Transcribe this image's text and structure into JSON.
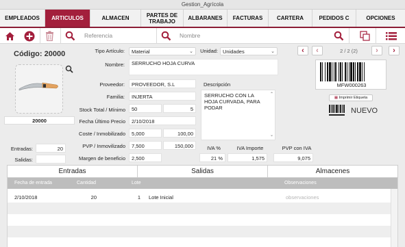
{
  "window": {
    "title": "Gestion_Agrícola"
  },
  "nav": {
    "tabs": [
      "EMPLEADOS",
      "ARTICULOS",
      "ALMACEN",
      "PARTES DE\nTRABAJO",
      "ALBARANES",
      "FACTURAS",
      "CARTERA",
      "PEDIDOS C",
      "OPCIONES"
    ],
    "active": 1
  },
  "toolbar": {
    "ref_placeholder": "Referencia",
    "name_placeholder": "Nombre"
  },
  "header": {
    "codigo": "Código: 20000",
    "record_position": "2 / 2 (2)"
  },
  "photo": {
    "caption": "20000"
  },
  "form": {
    "tipo_label": "Tipo Artículo:",
    "tipo_value": "Material",
    "unidad_label": "Unidad:",
    "unidad_value": "Unidades",
    "nombre_label": "Nombre:",
    "nombre_value": "SERRUCHO HOJA CURVA",
    "proveedor_label": "Proveedor:",
    "proveedor_value": "PROVEEDOR, S.L",
    "familia_label": "Familia:",
    "familia_value": "INJERTA",
    "stock_label": "Stock Total / Mínimo",
    "stock_total": "50",
    "stock_min": "5",
    "fecha_label": "Fecha Último Precio",
    "fecha_value": "2/10/2018",
    "coste_label": "Coste / Inmobilizado",
    "coste_value": "5,000",
    "inmob_value": "100,00",
    "pvp_label": "PVP / Inmovilizado",
    "pvp_value": "7,500",
    "pvp_inmob": "150,000",
    "margen_label": "Margen de beneficio",
    "margen_value": "2,500",
    "descripcion_label": "Descripción",
    "descripcion_value": "SERRUCHO CON LA HOJA CURVADA, PARA PODAR",
    "iva_pct_label": "IVA %",
    "iva_pct_value": "21 %",
    "iva_imp_label": "IVA Importe",
    "iva_imp_value": "1,575",
    "pvp_iva_label": "PVP con IVA",
    "pvp_iva_value": "9,075",
    "entradas_label": "Entradas:",
    "entradas_value": "20",
    "salidas_label": "Salidas:",
    "salidas_value": ""
  },
  "barcode": {
    "code": "MFW000263",
    "print_label": "Imprimir Etiqueta",
    "nuevo_label": "NUEVO"
  },
  "subtabs": [
    "Entradas",
    "Salidas",
    "Almacenes"
  ],
  "table": {
    "columns": [
      "Fecha de entrada",
      "Cantidad",
      "Lote",
      "Observaciones"
    ],
    "rows": [
      {
        "fecha": "2/10/2018",
        "cantidad": "20",
        "lote": "1",
        "desc": "Lote Inicial",
        "obs": "observaciones"
      }
    ]
  }
}
